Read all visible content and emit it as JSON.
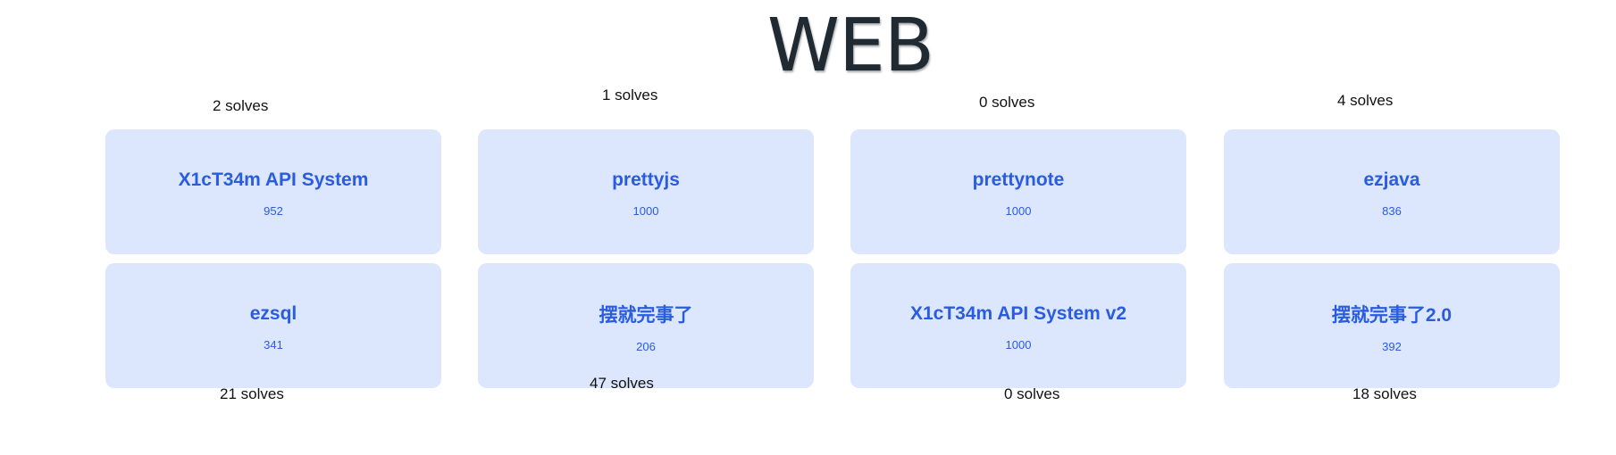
{
  "category": {
    "title": "WEB"
  },
  "challenges": [
    {
      "name": "X1cT34m API System",
      "points": "952",
      "solves": "2 solves"
    },
    {
      "name": "prettyjs",
      "points": "1000",
      "solves": "1 solves"
    },
    {
      "name": "prettynote",
      "points": "1000",
      "solves": "0 solves"
    },
    {
      "name": "ezjava",
      "points": "836",
      "solves": "4 solves"
    },
    {
      "name": "ezsql",
      "points": "341",
      "solves": "21 solves"
    },
    {
      "name": "摆就完事了",
      "points": "206",
      "solves": "47 solves"
    },
    {
      "name": "X1cT34m API System v2",
      "points": "1000",
      "solves": "0 solves"
    },
    {
      "name": "摆就完事了2.0",
      "points": "392",
      "solves": "18 solves"
    }
  ]
}
